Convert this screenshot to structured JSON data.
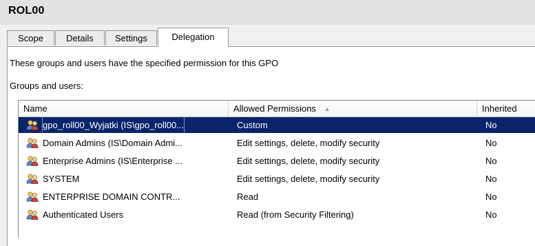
{
  "window": {
    "title": "ROL00"
  },
  "tabs": [
    {
      "label": "Scope"
    },
    {
      "label": "Details"
    },
    {
      "label": "Settings"
    },
    {
      "label": "Delegation"
    }
  ],
  "delegation": {
    "description": "These groups and users have the specified permission for this GPO",
    "groups_label": "Groups and users:",
    "columns": {
      "name": "Name",
      "permissions": "Allowed Permissions",
      "inherited": "Inherited"
    },
    "sort_indicator": "▲",
    "rows": [
      {
        "name": "gpo_roll00_Wyjatki (IS\\gpo_roll00...",
        "permissions": "Custom",
        "inherited": "No",
        "selected": true,
        "icon": "user-group-icon"
      },
      {
        "name": "Domain Admins (IS\\Domain Admi...",
        "permissions": "Edit settings, delete, modify security",
        "inherited": "No",
        "icon": "user-group-icon"
      },
      {
        "name": "Enterprise Admins (IS\\Enterprise ...",
        "permissions": "Edit settings, delete, modify security",
        "inherited": "No",
        "icon": "user-group-icon"
      },
      {
        "name": "SYSTEM",
        "permissions": "Edit settings, delete, modify security",
        "inherited": "No",
        "icon": "user-group-icon"
      },
      {
        "name": "ENTERPRISE DOMAIN CONTR...",
        "permissions": "Read",
        "inherited": "No",
        "icon": "user-group-icon"
      },
      {
        "name": "Authenticated Users",
        "permissions": "Read (from Security Filtering)",
        "inherited": "No",
        "icon": "user-group-icon"
      }
    ]
  },
  "colors": {
    "selection": "#0a246a",
    "title_bar": "#e2e2e2"
  }
}
